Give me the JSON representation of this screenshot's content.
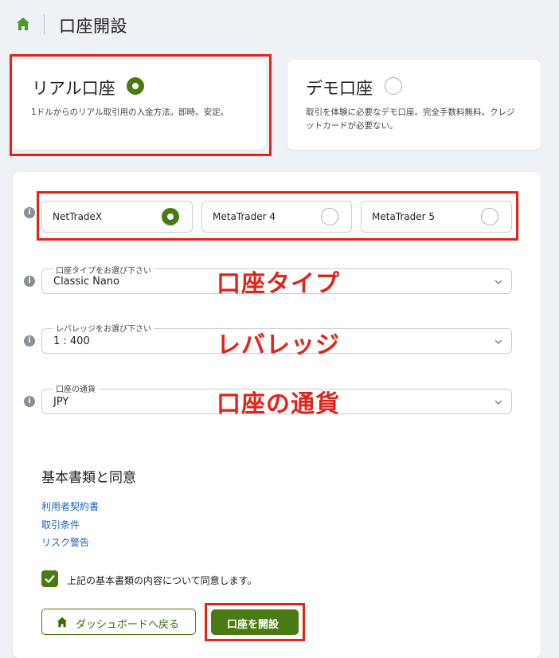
{
  "header": {
    "title": "口座開設"
  },
  "account_types": {
    "real": {
      "title": "リアル口座",
      "description": "1ドルからのリアル取引用の入金方法。即時。安定。",
      "selected": true
    },
    "demo": {
      "title": "デモ口座",
      "description_line1": "取引を体験に必要なデモ口座。完全手数料無料。クレジ",
      "description_line2": "ットカードが必要ない。",
      "selected": false
    }
  },
  "platforms": [
    {
      "label": "NetTradeX",
      "selected": true
    },
    {
      "label": "MetaTrader 4",
      "selected": false
    },
    {
      "label": "MetaTrader 5",
      "selected": false
    }
  ],
  "fields": {
    "account_type": {
      "legend": "口座タイプをお選び下さい",
      "value": "Classic Nano"
    },
    "leverage": {
      "legend": "レバレッジをお選び下さい",
      "value": "1 : 400"
    },
    "currency": {
      "legend": "口座の通貨",
      "value": "JPY"
    }
  },
  "annotations": {
    "account_type": "口座タイプ",
    "leverage": "レバレッジ",
    "currency": "口座の通貨"
  },
  "documents": {
    "heading": "基本書類と同意",
    "links": [
      "利用者契約書",
      "取引条件",
      "リスク警告"
    ],
    "agree_label": "上記の基本書類の内容について同意します。",
    "agreed": true
  },
  "actions": {
    "back_label": "ダッシュボードへ戻る",
    "open_label": "口座を開設"
  },
  "colors": {
    "accent": "#4a7a12",
    "highlight": "#e2231a",
    "link": "#1a62c7"
  }
}
